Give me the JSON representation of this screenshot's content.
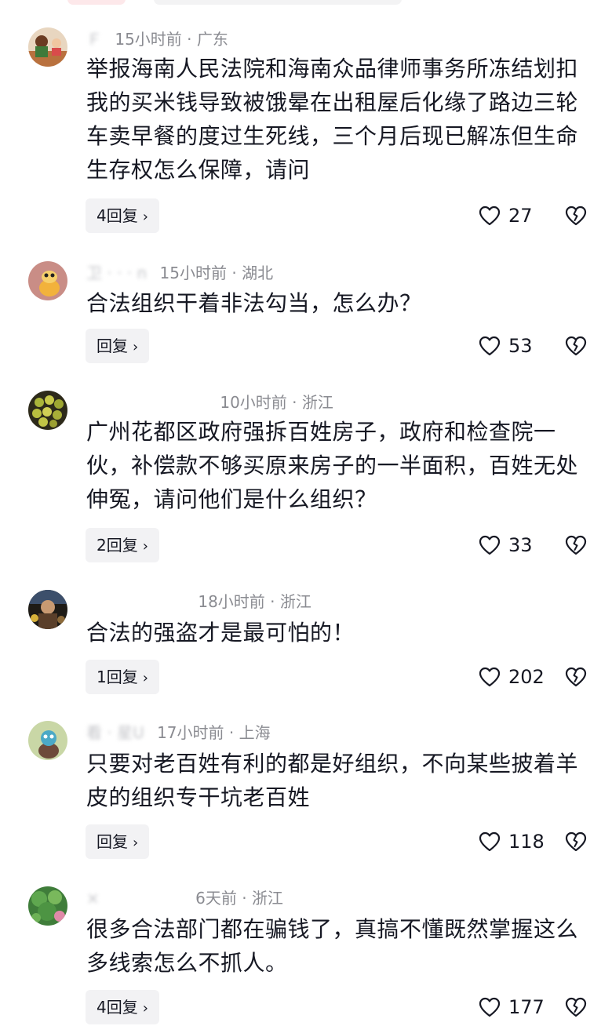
{
  "comments": [
    {
      "username": "Ｆ",
      "time": "15小时前",
      "separator": "·",
      "location": "广东",
      "text": "举报海南人民法院和海南众品律师事务所冻结划扣我的买米钱导致被饿晕在出租屋后化缘了路边三轮车卖早餐的度过生死线，三个月后现已解冻但生命生存权怎么保障，请问",
      "reply_label": "4回复",
      "reply_chevron": "›",
      "likes": "27"
    },
    {
      "username": "卫  ·  ·  ·  n",
      "time": "15小时前",
      "separator": "·",
      "location": "湖北",
      "text": "合法组织干着非法勾当，怎么办？",
      "reply_label": "回复",
      "reply_chevron": "›",
      "likes": "53"
    },
    {
      "username": "",
      "time": "10小时前",
      "separator": "·",
      "location": "浙江",
      "text": "广州花都区政府强拆百姓房子，政府和检查院一伙，补偿款不够买原来房子的一半面积，百姓无处伸冤，请问他们是什么组织？",
      "reply_label": "2回复",
      "reply_chevron": "›",
      "likes": "33"
    },
    {
      "username": "",
      "time": "18小时前",
      "separator": "·",
      "location": "浙江",
      "text": "合法的强盗才是最可怕的！",
      "reply_label": "1回复",
      "reply_chevron": "›",
      "likes": "202"
    },
    {
      "username": "看  · 星U",
      "time": "17小时前",
      "separator": "·",
      "location": "上海",
      "text": "只要对老百姓有利的都是好组织，不向某些披着羊皮的组织专干坑老百姓",
      "reply_label": "回复",
      "reply_chevron": "›",
      "likes": "118"
    },
    {
      "username": "×",
      "time": "6天前",
      "separator": "·",
      "location": "浙江",
      "text": "很多合法部门都在骗钱了，真搞不懂既然掌握这么多线索怎么不抓人。",
      "reply_label": "4回复",
      "reply_chevron": "›",
      "likes": "177"
    }
  ],
  "icons": {
    "like": "heart-outline-icon",
    "dislike": "broken-heart-icon"
  },
  "colors": {
    "text_primary": "#161823",
    "text_secondary": "#8a8b91",
    "reply_bg": "#f2f2f4"
  }
}
